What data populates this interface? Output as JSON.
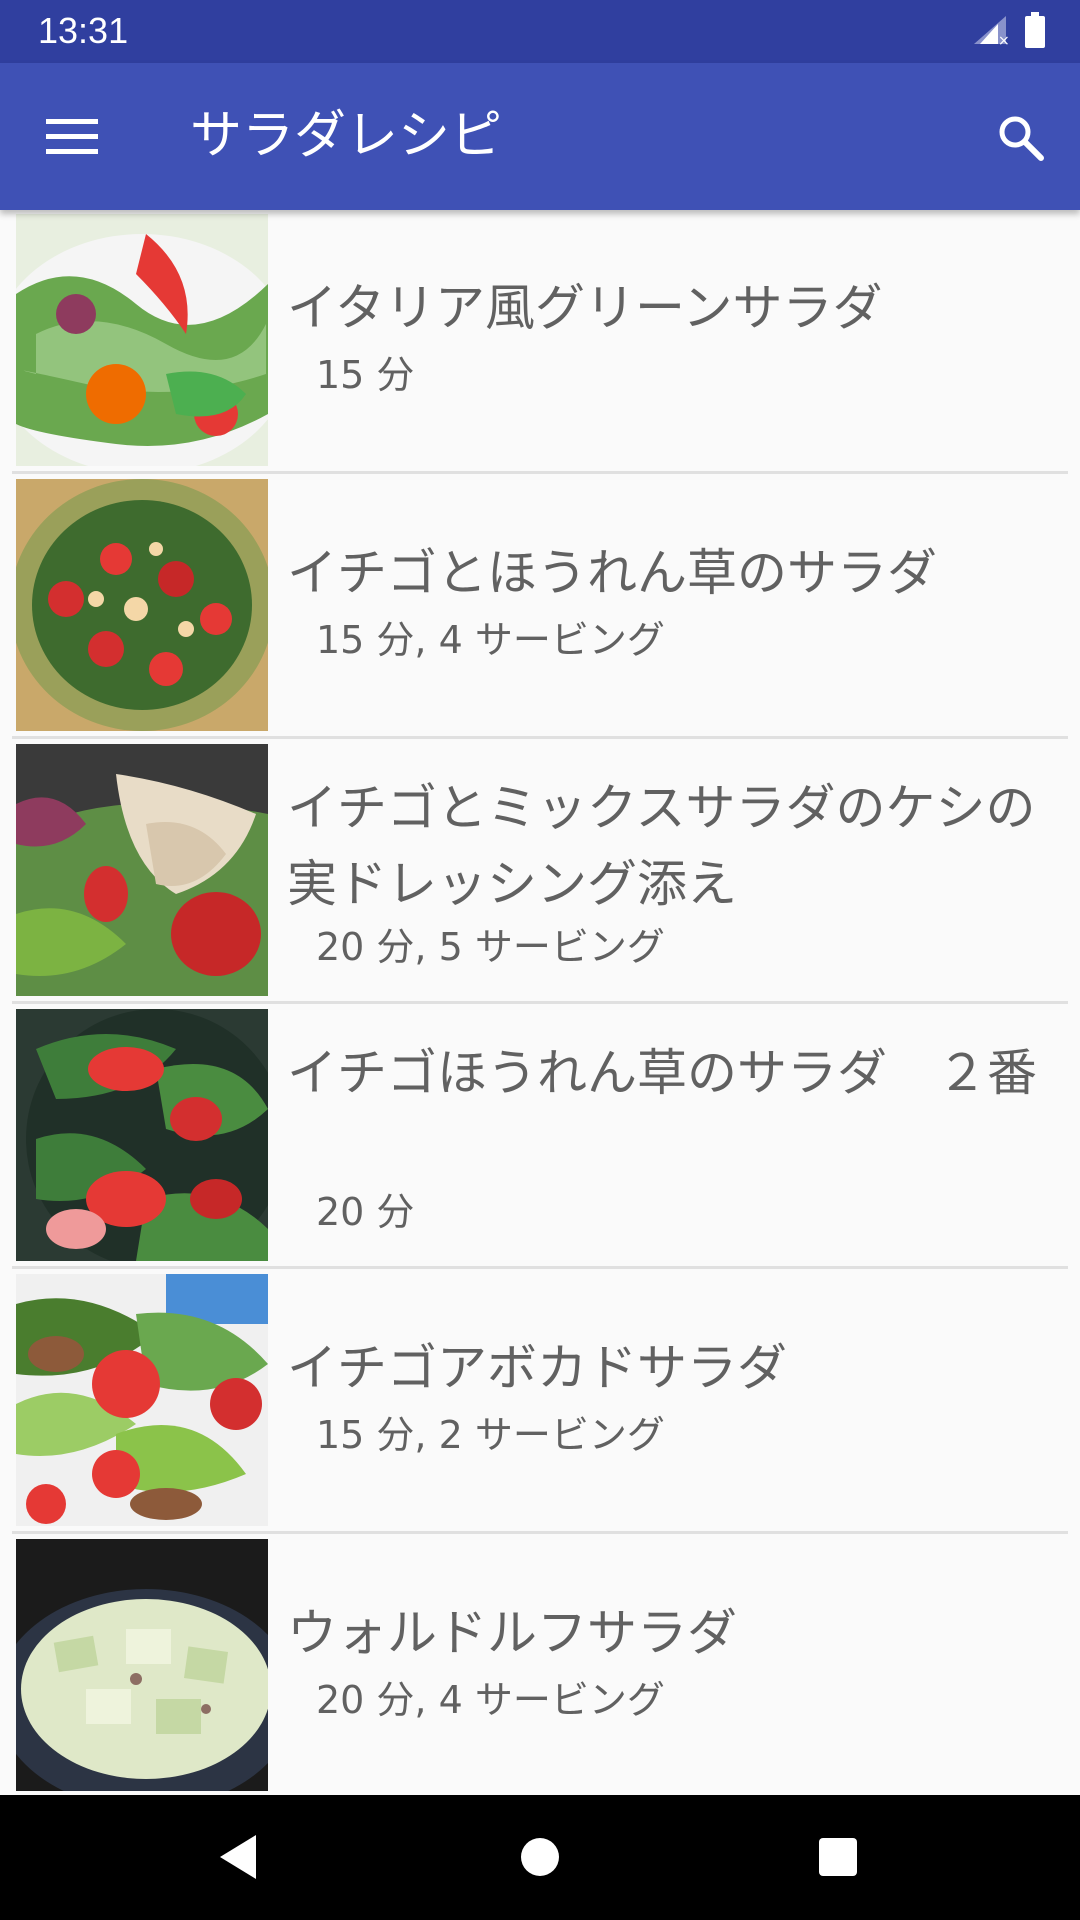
{
  "status_bar": {
    "time": "13:31",
    "icons": [
      "signal-icon",
      "battery-icon"
    ]
  },
  "app_bar": {
    "title": "サラダレシピ",
    "menu_icon": "hamburger-menu-icon",
    "search_icon": "search-icon",
    "color": "#3f51b5"
  },
  "recipes": [
    {
      "title": "イタリア風グリーンサラダ",
      "meta": "15 分"
    },
    {
      "title": "イチゴとほうれん草のサラダ",
      "meta": "15 分, 4 サービング"
    },
    {
      "title": "イチゴとミックスサラダのケシの実ドレッシング添え",
      "meta": "20 分, 5 サービング"
    },
    {
      "title": "イチゴほうれん草のサラダ　２番",
      "meta": "20 分"
    },
    {
      "title": "イチゴアボカドサラダ",
      "meta": "15 分, 2 サービング"
    },
    {
      "title": "ウォルドルフサラダ",
      "meta": "20 分, 4 サービング"
    }
  ],
  "nav_bar": {
    "buttons": [
      "back-icon",
      "home-icon",
      "recents-icon"
    ]
  }
}
